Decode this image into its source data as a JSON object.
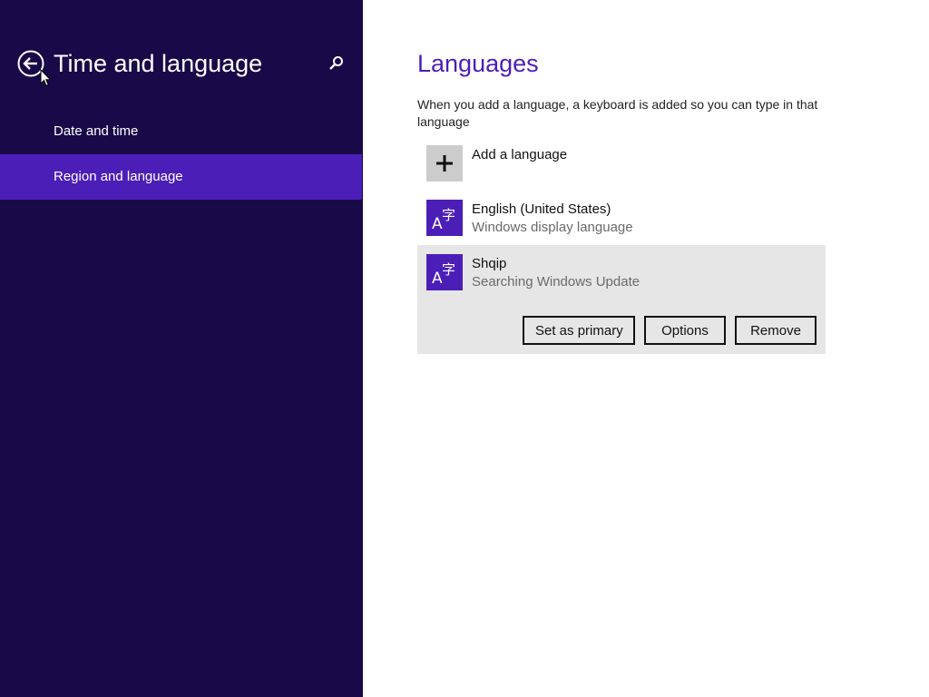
{
  "left_pane": {
    "title": "Time and language",
    "back_icon": "back-arrow-circle-icon",
    "search_icon": "search-icon",
    "nav_items": [
      {
        "label": "Date and time",
        "selected": false
      },
      {
        "label": "Region and language",
        "selected": true
      }
    ],
    "background_color": "#180a48",
    "selected_color": "#4c1eb8"
  },
  "content": {
    "title": "Languages",
    "description": "When you add a language, a keyboard is added so you can type in that language",
    "add_language": {
      "label": "Add a language",
      "icon": "plus-icon"
    },
    "languages": [
      {
        "name": "English (United States)",
        "status": "Windows display language",
        "icon": "language-glyph-icon",
        "selected": false
      },
      {
        "name": "Shqip",
        "status": "Searching Windows Update",
        "icon": "language-glyph-icon",
        "selected": true
      }
    ],
    "actions": {
      "set_primary": "Set as primary",
      "options": "Options",
      "remove": "Remove"
    },
    "accent_color": "#4c1eb8"
  }
}
